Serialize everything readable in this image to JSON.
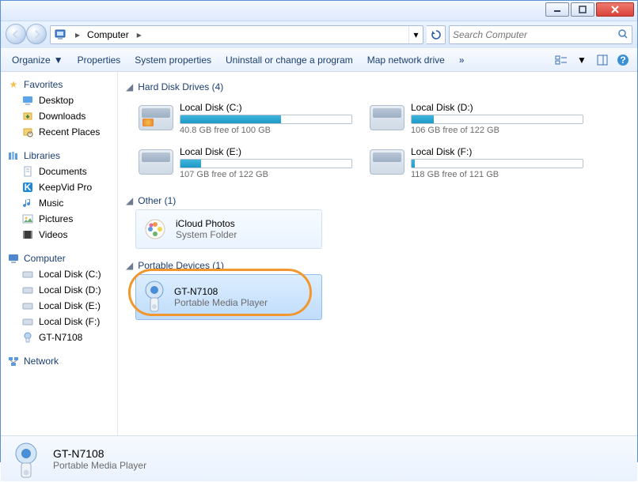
{
  "address": {
    "location": "Computer",
    "search_placeholder": "Search Computer"
  },
  "toolbar": {
    "organize": "Organize",
    "properties": "Properties",
    "system_properties": "System properties",
    "uninstall": "Uninstall or change a program",
    "map_drive": "Map network drive",
    "more": "»"
  },
  "nav": {
    "favorites": "Favorites",
    "desktop": "Desktop",
    "downloads": "Downloads",
    "recent": "Recent Places",
    "libraries": "Libraries",
    "documents": "Documents",
    "keepvid": "KeepVid Pro",
    "music": "Music",
    "pictures": "Pictures",
    "videos": "Videos",
    "computer": "Computer",
    "ldc": "Local Disk (C:)",
    "ldd": "Local Disk (D:)",
    "lde": "Local Disk (E:)",
    "ldf": "Local Disk (F:)",
    "gt": "GT-N7108",
    "network": "Network"
  },
  "groups": {
    "hdd": "Hard Disk Drives (4)",
    "other": "Other (1)",
    "portable": "Portable Devices (1)"
  },
  "drives": [
    {
      "name": "Local Disk (C:)",
      "info": "40.8 GB free of 100 GB",
      "pct": 59
    },
    {
      "name": "Local Disk (D:)",
      "info": "106 GB free of 122 GB",
      "pct": 13
    },
    {
      "name": "Local Disk (E:)",
      "info": "107 GB free of 122 GB",
      "pct": 12
    },
    {
      "name": "Local Disk (F:)",
      "info": "118 GB free of 121 GB",
      "pct": 2
    }
  ],
  "other_item": {
    "name": "iCloud Photos",
    "sub": "System Folder"
  },
  "portable_item": {
    "name": "GT-N7108",
    "sub": "Portable Media Player"
  },
  "details": {
    "title": "GT-N7108",
    "sub": "Portable Media Player"
  }
}
